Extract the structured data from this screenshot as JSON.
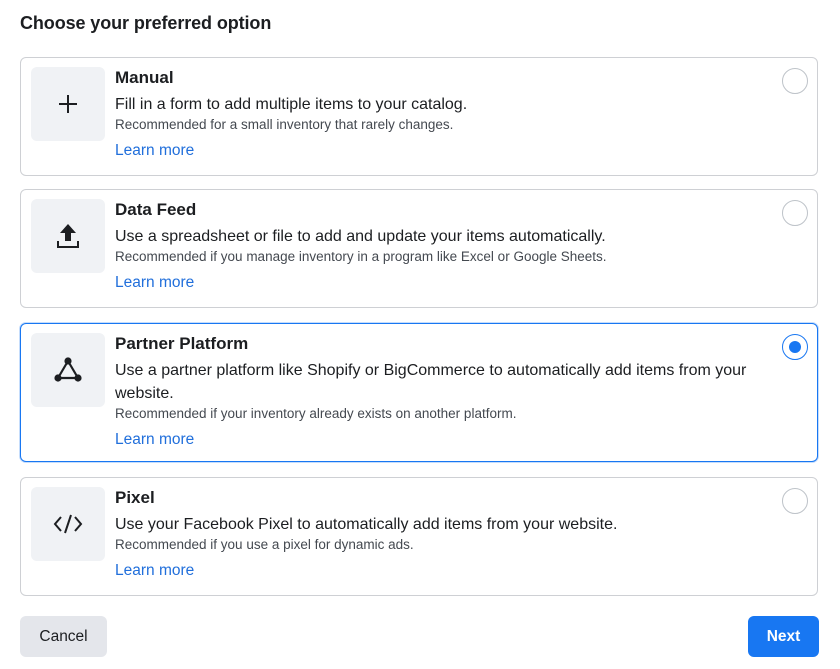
{
  "heading": "Choose your preferred option",
  "options": [
    {
      "title": "Manual",
      "description": "Fill in a form to add multiple items to your catalog.",
      "note": "Recommended for a small inventory that rarely changes.",
      "link": "Learn more",
      "icon": "plus-icon",
      "selected": false
    },
    {
      "title": "Data Feed",
      "description": "Use a spreadsheet or file to add and update your items automatically.",
      "note": "Recommended if you manage inventory in a program like Excel or Google Sheets.",
      "link": "Learn more",
      "icon": "upload-icon",
      "selected": false
    },
    {
      "title": "Partner Platform",
      "description": "Use a partner platform like Shopify or BigCommerce to automatically add items from your website.",
      "note": "Recommended if your inventory already exists on another platform.",
      "link": "Learn more",
      "icon": "network-nodes-icon",
      "selected": true
    },
    {
      "title": "Pixel",
      "description": "Use your Facebook Pixel to automatically add items from your website.",
      "note": "Recommended if you use a pixel for dynamic ads.",
      "link": "Learn more",
      "icon": "code-icon",
      "selected": false
    }
  ],
  "footer": {
    "cancel_label": "Cancel",
    "next_label": "Next"
  },
  "colors": {
    "accent": "#1877f2",
    "link": "#216fdb",
    "border": "#ced0d4",
    "icon_bg": "#f0f2f5"
  }
}
